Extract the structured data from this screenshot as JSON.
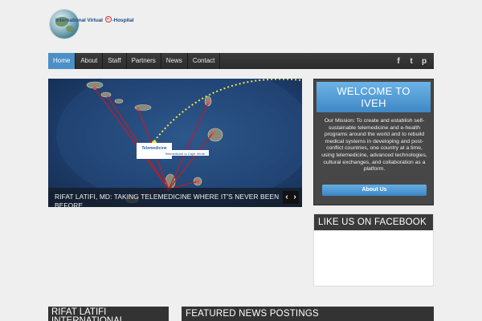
{
  "logo": {
    "part1": "International Virtual ",
    "part2": "-Hospital"
  },
  "nav": {
    "items": [
      {
        "label": "Home",
        "active": true
      },
      {
        "label": "About"
      },
      {
        "label": "Staff"
      },
      {
        "label": "Partners"
      },
      {
        "label": "News"
      },
      {
        "label": "Contact"
      }
    ],
    "social_icons": [
      "facebook-icon",
      "twitter-icon",
      "pinterest-icon"
    ],
    "social_glyphs": [
      "f",
      "t",
      "p"
    ]
  },
  "slider": {
    "caption": "Rifat Latifi, MD: Taking Telemedicine Where It's Never Been Before",
    "map_label": "Telemedicine",
    "map_sublabel": "Telemedicine to Cape Verde",
    "prev_glyph": "‹",
    "next_glyph": "›"
  },
  "welcome": {
    "title_line1": "WELCOME TO",
    "title_line2": "IVEH",
    "mission": "Our Mission: To create and establish self-sustainable telemedicine and e-health programs around the world and to rebuild medical systems in developing and post-conflict countries, one country at a time, using telemedicine, advanced technologies, cultural exchanges, and collaboration as a platform.",
    "button": "About Us"
  },
  "facebook": {
    "title": "LIKE US ON FACEBOOK"
  },
  "bottom": {
    "left_title": "RIFAT LATIFI INTERNATIONAL",
    "right_title": "FEATURED NEWS POSTINGS"
  },
  "colors": {
    "accent": "#4a8fc6",
    "nav_bg": "#333333",
    "map_line": "#b3202a",
    "route_dots": "#f2e24a"
  }
}
